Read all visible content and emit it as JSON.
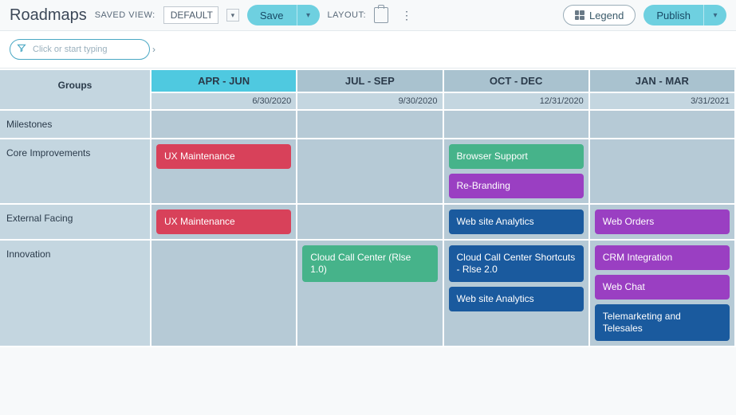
{
  "header": {
    "title": "Roadmaps",
    "saved_view_label": "SAVED VIEW:",
    "saved_view_value": "DEFAULT",
    "save_label": "Save",
    "layout_label": "LAYOUT:",
    "legend_label": "Legend",
    "publish_label": "Publish"
  },
  "filter": {
    "placeholder": "Click or start typing"
  },
  "columns": {
    "groups_label": "Groups",
    "quarters": [
      {
        "label": "APR - JUN",
        "date": "6/30/2020",
        "active": true
      },
      {
        "label": "JUL - SEP",
        "date": "9/30/2020",
        "active": false
      },
      {
        "label": "OCT - DEC",
        "date": "12/31/2020",
        "active": false
      },
      {
        "label": "JAN - MAR",
        "date": "3/31/2021",
        "active": false
      }
    ]
  },
  "rows": [
    {
      "name": "Milestones",
      "size": "sm",
      "cells": [
        [],
        [],
        [],
        []
      ]
    },
    {
      "name": "Core Improvements",
      "size": "md",
      "cells": [
        [
          {
            "text": "UX Maintenance",
            "color": "red"
          }
        ],
        [],
        [
          {
            "text": "Browser Support",
            "color": "green"
          },
          {
            "text": "Re-Branding",
            "color": "purple"
          }
        ],
        []
      ]
    },
    {
      "name": "External Facing",
      "size": "sm",
      "cells": [
        [
          {
            "text": "UX Maintenance",
            "color": "red"
          }
        ],
        [],
        [
          {
            "text": "Web site Analytics",
            "color": "blue"
          }
        ],
        [
          {
            "text": "Web Orders",
            "color": "purple"
          }
        ]
      ]
    },
    {
      "name": "Innovation",
      "size": "lg",
      "cells": [
        [],
        [
          {
            "text": "Cloud Call Center (Rlse 1.0)",
            "color": "green"
          }
        ],
        [
          {
            "text": "Cloud Call Center Shortcuts - Rlse 2.0",
            "color": "blue"
          },
          {
            "text": "Web site Analytics",
            "color": "blue"
          }
        ],
        [
          {
            "text": "CRM Integration",
            "color": "purple"
          },
          {
            "text": "Web Chat",
            "color": "purple"
          },
          {
            "text": "Telemarketing and Telesales",
            "color": "blue"
          }
        ]
      ]
    }
  ],
  "colors": {
    "red": "#d8415a",
    "green": "#46b38a",
    "purple": "#9a3fc2",
    "blue": "#1a5a9e"
  }
}
